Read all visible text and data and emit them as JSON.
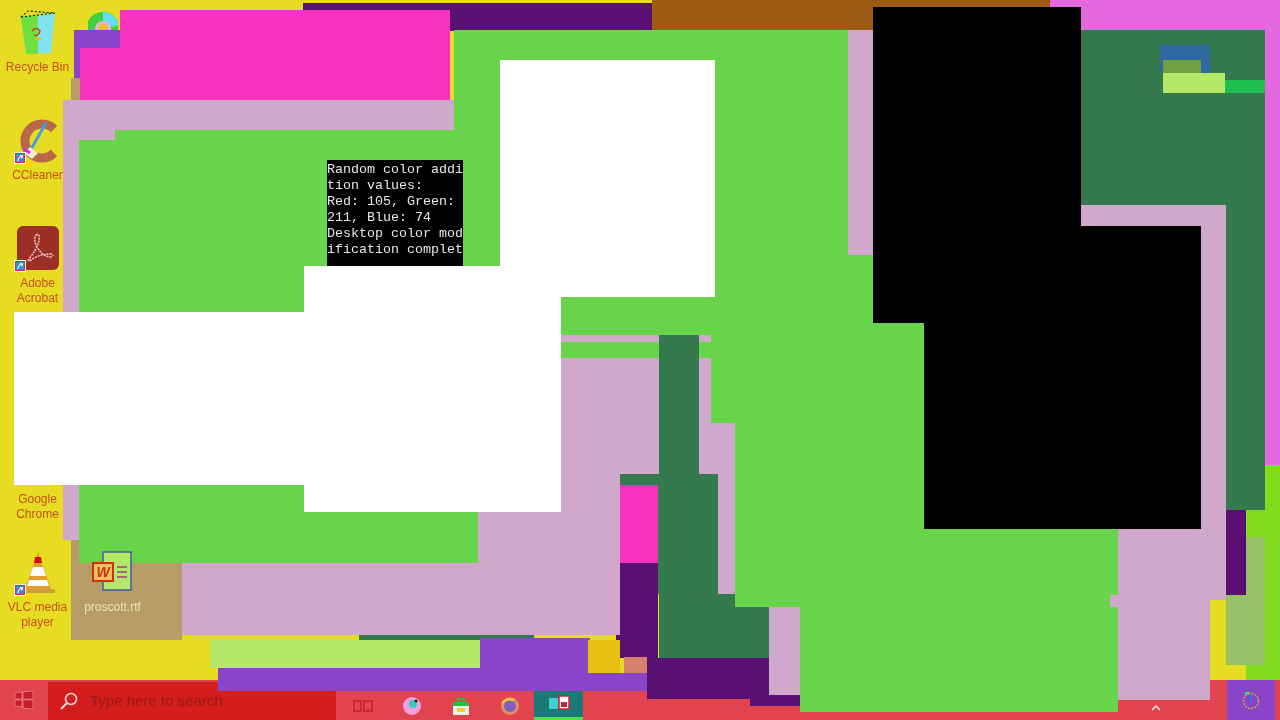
{
  "desktop_icons": [
    {
      "label": "Recycle Bin",
      "kind": "recycle-bin",
      "shortcut": false
    },
    {
      "label": "CCleaner",
      "kind": "ccleaner",
      "shortcut": true
    },
    {
      "label": "Adobe Acrobat",
      "kind": "acrobat",
      "shortcut": true
    },
    {
      "label": "Google Chrome",
      "kind": "covered",
      "shortcut": false
    },
    {
      "label": "VLC media player",
      "kind": "vlc",
      "shortcut": true
    },
    {
      "label": "proscott.rtf",
      "kind": "document",
      "shortcut": false,
      "icon_letter": "W"
    }
  ],
  "console": {
    "lines": [
      "Random color addition values:",
      "Red: 105, Green: 211, Blue: 74",
      "Desktop color modification complet"
    ]
  },
  "taskbar": {
    "search": {
      "placeholder": "Type here to search"
    },
    "apps": [
      {
        "kind": "task-view",
        "selected": false
      },
      {
        "kind": "round-browser",
        "selected": false
      },
      {
        "kind": "store",
        "selected": false
      },
      {
        "kind": "fox-browser",
        "selected": false
      },
      {
        "kind": "app-window",
        "selected": true
      }
    ]
  }
}
